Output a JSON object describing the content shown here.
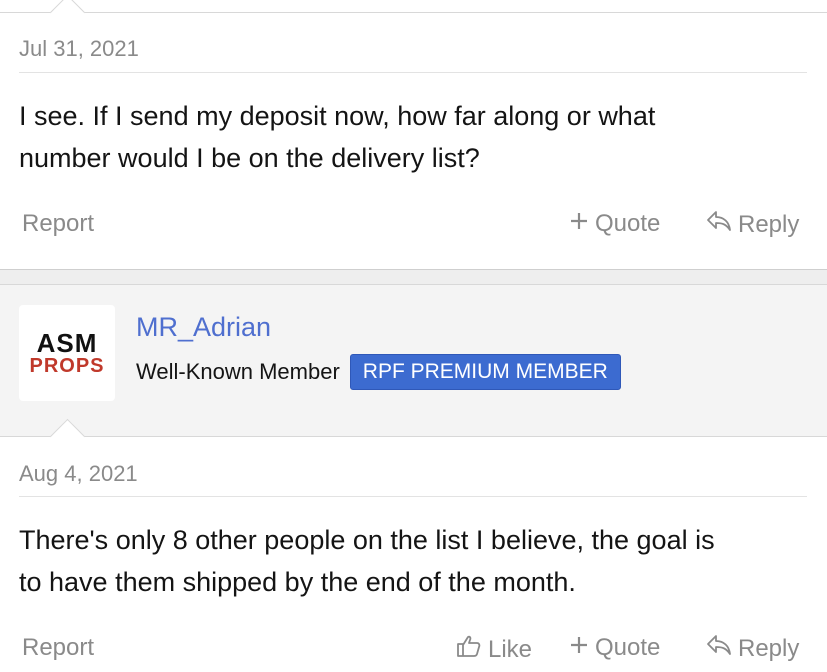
{
  "post1": {
    "date": "Jul 31, 2021",
    "message_line1": "I see. If I send my deposit now, how far along or what",
    "message_line2": "number would I be on the delivery list?",
    "report_label": "Report",
    "quote_label": "Quote",
    "reply_label": "Reply"
  },
  "post2": {
    "author": {
      "username": "MR_Adrian",
      "title": "Well-Known Member",
      "badge": "RPF PREMIUM MEMBER",
      "avatar_logo_top": "ASM",
      "avatar_logo_bottom": "PROPS"
    },
    "date": "Aug 4, 2021",
    "message_line1": "There's only 8 other people on the list I believe, the goal is",
    "message_line2": "to have them shipped by the end of the month.",
    "report_label": "Report",
    "like_label": "Like",
    "quote_label": "Quote",
    "reply_label": "Reply"
  },
  "colors": {
    "link_blue": "#4f6fcf",
    "badge_blue": "#3c6bd0",
    "muted_text": "#8a8a8a",
    "divider": "#d8d8d8"
  }
}
